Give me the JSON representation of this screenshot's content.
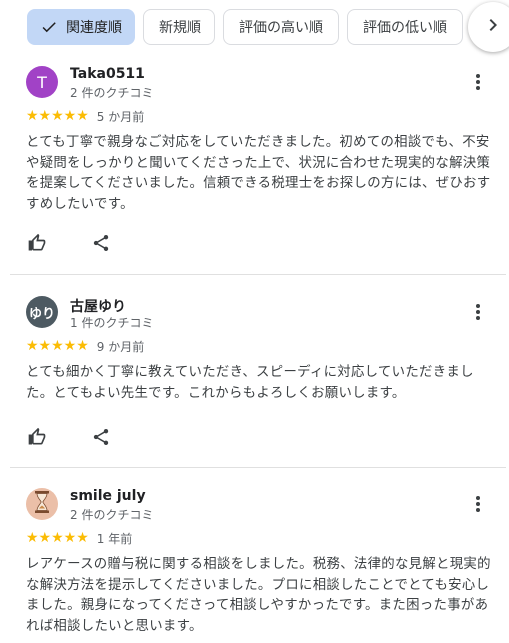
{
  "sort_chips": [
    {
      "label": "関連度順",
      "selected": true
    },
    {
      "label": "新規順",
      "selected": false
    },
    {
      "label": "評価の高い順",
      "selected": false
    },
    {
      "label": "評価の低い順",
      "selected": false
    }
  ],
  "reviews": [
    {
      "avatar_letter": "T",
      "avatar_color": "#a142c6",
      "name": "Taka0511",
      "review_count": "2 件のクチコミ",
      "rating": 5,
      "stars": "★★★★★",
      "when": "5 か月前",
      "text": "とても丁寧で親身なご対応をしていただきました。初めての相談でも、不安や疑問をしっかりと聞いてくださった上で、状況に合わせた現実的な解決策を提案してくださいました。信頼できる税理士をお探しの方には、ぜひおすすめしたいです。"
    },
    {
      "avatar_letter": "ゆり",
      "avatar_color": "#4d5a62",
      "name": "古屋ゆり",
      "review_count": "1 件のクチコミ",
      "rating": 5,
      "stars": "★★★★★",
      "when": "9 か月前",
      "text": "とても細かく丁寧に教えていただき、スピーディに対応していただきました。とてもよい先生です。これからもよろしくお願いします。"
    },
    {
      "avatar_letter": "",
      "avatar_color": "#ebbfa8",
      "name": "smile july",
      "review_count": "2 件のクチコミ",
      "rating": 5,
      "stars": "★★★★★",
      "when": "1 年前",
      "text": "レアケースの贈与税に関する相談をしました。税務、法律的な見解と現実的な解決方法を提示してくださいました。プロに相談したことでとても安心しました。親身になってくださって相談しやすかったです。また困った事があれば相談したいと思います。"
    }
  ],
  "icons": {
    "check": "check-icon",
    "scroll": "chevron-right-icon",
    "more": "more-vert-icon",
    "like": "thumb-up-icon",
    "share": "share-icon"
  },
  "colors": {
    "accent_chip": "#c2d7f6",
    "star": "#fbbc04"
  }
}
